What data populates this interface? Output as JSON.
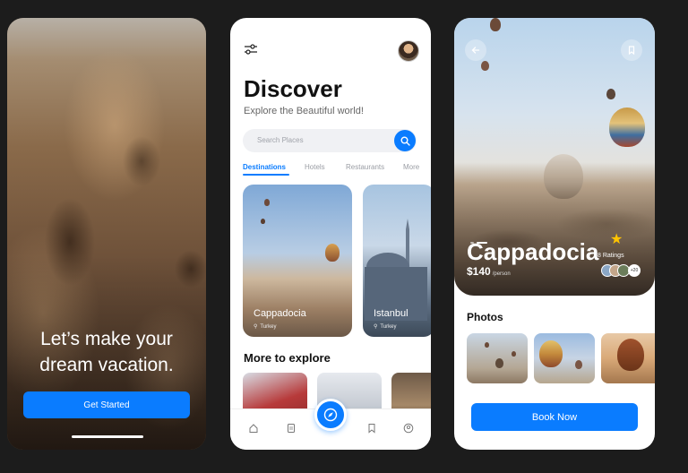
{
  "onboarding": {
    "headline_line1": "Let’s make your",
    "headline_line2": "dream vacation.",
    "cta_label": "Get Started"
  },
  "discover": {
    "title": "Discover",
    "subtitle": "Explore the Beautiful world!",
    "search_placeholder": "Search Places",
    "tabs": [
      {
        "label": "Destinations",
        "active": true
      },
      {
        "label": "Hotels",
        "active": false
      },
      {
        "label": "Restaurants",
        "active": false
      },
      {
        "label": "More",
        "active": false
      }
    ],
    "places": [
      {
        "name": "Cappadocia",
        "location": "Turkey"
      },
      {
        "name": "Istanbul",
        "location": "Turkey"
      }
    ],
    "more_title": "More to explore",
    "nav_icons": [
      "home-icon",
      "document-icon",
      "compass-icon",
      "bookmark-icon",
      "profile-icon"
    ]
  },
  "detail": {
    "title": "Cappadocia",
    "price": "$140",
    "price_unit": "/person",
    "ratings": "8 Ratings",
    "rating_more": "+20",
    "photos_title": "Photos",
    "book_label": "Book Now"
  },
  "colors": {
    "accent": "#0a7cff",
    "star": "#ffc400",
    "background": "#1c1c1c"
  }
}
